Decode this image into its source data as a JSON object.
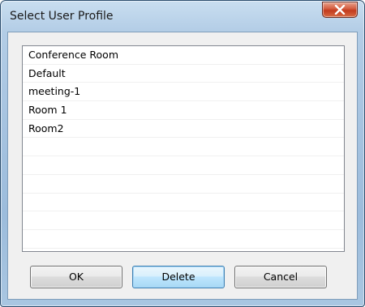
{
  "window": {
    "title": "Select User Profile"
  },
  "profiles": {
    "items": [
      "Conference Room",
      "Default",
      "meeting-1",
      "Room 1",
      "Room2"
    ],
    "empty_rows": 6
  },
  "buttons": {
    "ok_label": "OK",
    "delete_label": "Delete",
    "cancel_label": "Cancel"
  },
  "colors": {
    "frame": "#a9c6e1",
    "close_button": "#c23a1d",
    "default_button_border": "#3c7fb1"
  }
}
